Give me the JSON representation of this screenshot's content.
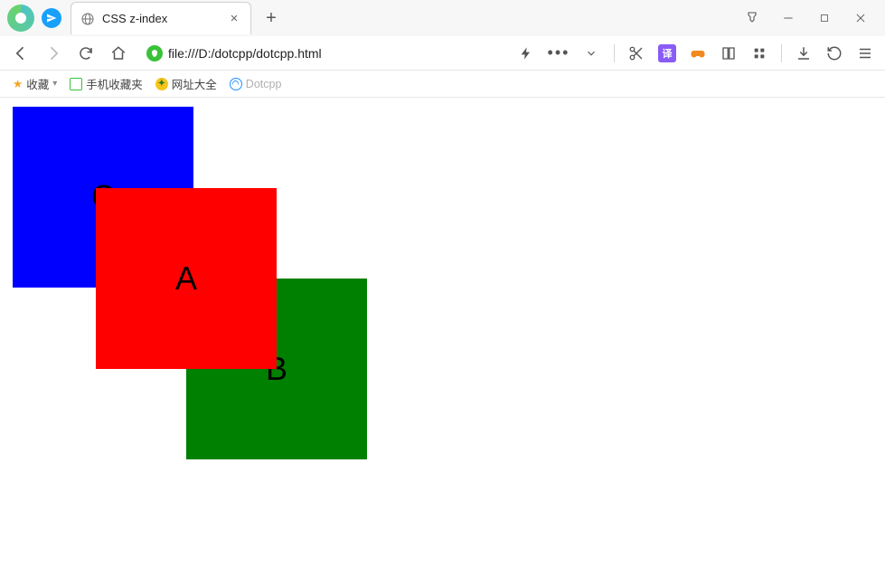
{
  "tab": {
    "title": "CSS z-index"
  },
  "url": "file:///D:/dotcpp/dotcpp.html",
  "bookmarks": {
    "fav": "收藏",
    "mobile": "手机收藏夹",
    "sites": "网址大全",
    "dotcpp": "Dotcpp"
  },
  "toolbar": {
    "translate": "译"
  },
  "boxes": {
    "a": "A",
    "b": "B",
    "c": "C"
  }
}
